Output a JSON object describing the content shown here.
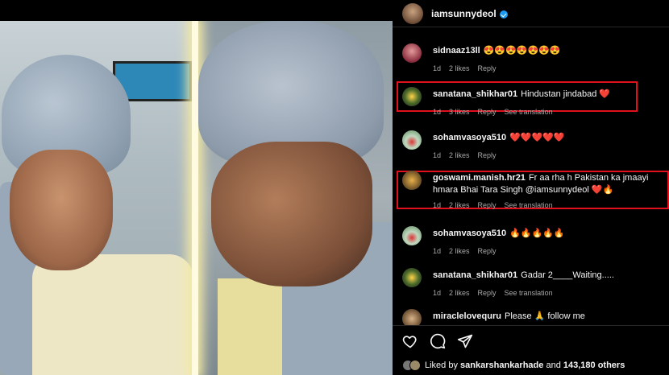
{
  "post": {
    "author": "iamsunnydeol",
    "verified": true
  },
  "comments": [
    {
      "user": "sidnaaz13ll",
      "text": "😍😍😍😍😍😍😍",
      "time": "1d",
      "likes": "2 likes",
      "reply": "Reply",
      "translation": ""
    },
    {
      "user": "sanatana_shikhar01",
      "text": "Hindustan jindabad ❤️",
      "time": "1d",
      "likes": "3 likes",
      "reply": "Reply",
      "translation": "See translation",
      "highlighted": true
    },
    {
      "user": "sohamvasoya510",
      "text": "❤️❤️❤️❤️❤️",
      "time": "1d",
      "likes": "2 likes",
      "reply": "Reply",
      "translation": ""
    },
    {
      "user": "goswami.manish.hr21",
      "text": "Fr aa rha h Pakistan ka jmaayi hmara Bhai Tara Singh @iamsunnydeol ❤️🔥",
      "time": "1d",
      "likes": "2 likes",
      "reply": "Reply",
      "translation": "See translation",
      "highlighted": true
    },
    {
      "user": "sohamvasoya510",
      "text": "🔥🔥🔥🔥🔥",
      "time": "1d",
      "likes": "2 likes",
      "reply": "Reply",
      "translation": ""
    },
    {
      "user": "sanatana_shikhar01",
      "text": "Gadar 2____Waiting.....",
      "time": "1d",
      "likes": "2 likes",
      "reply": "Reply",
      "translation": "See translation"
    },
    {
      "user": "miraclelovequru",
      "text": "Please 🙏 follow me",
      "time": "",
      "likes": "",
      "reply": "",
      "translation": ""
    }
  ],
  "actions": {
    "like_icon": "heart-icon",
    "comment_icon": "comment-icon",
    "share_icon": "share-icon"
  },
  "likes": {
    "prefix": "Liked by",
    "user": "sankarshankarhade",
    "middle": "and",
    "count": "143,180 others"
  },
  "colors": {
    "highlight": "#e0101c",
    "verified": "#1d9bf0",
    "background": "#000000"
  }
}
